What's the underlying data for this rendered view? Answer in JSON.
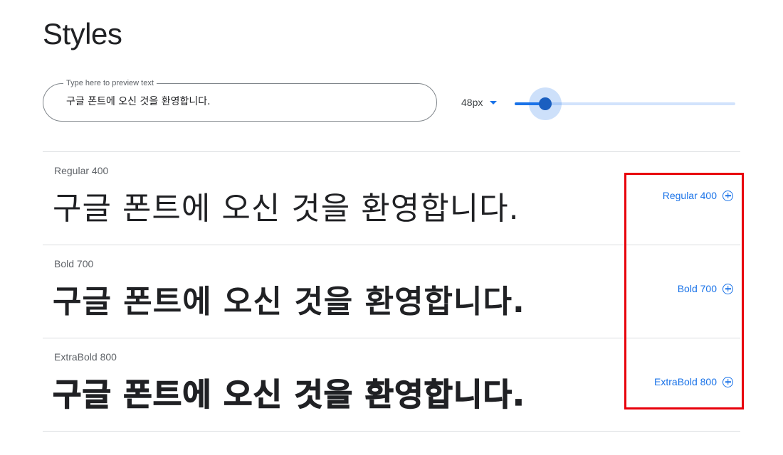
{
  "header": {
    "title": "Styles"
  },
  "preview": {
    "legend": "Type here to preview text",
    "value": "구글 폰트에 오신 것을 환영합니다."
  },
  "size": {
    "value": "48px",
    "slider_level_fraction": 0.14
  },
  "styles": [
    {
      "name": "Regular 400",
      "sample": "구글 폰트에 오신 것을 환영합니다.",
      "action": "Regular 400"
    },
    {
      "name": "Bold 700",
      "sample": "구글 폰트에 오신 것을 환영합니다.",
      "action": "Bold 700"
    },
    {
      "name": "ExtraBold 800",
      "sample": "구글 폰트에 오신 것을 환영합니다.",
      "action": "ExtraBold 800"
    }
  ],
  "colors": {
    "accent": "#1a73e8",
    "highlight": "#e8000b",
    "text": "#202124",
    "muted": "#5f6368"
  },
  "icons": {
    "add": "add-circle-icon",
    "dropdown": "caret-down-icon"
  }
}
